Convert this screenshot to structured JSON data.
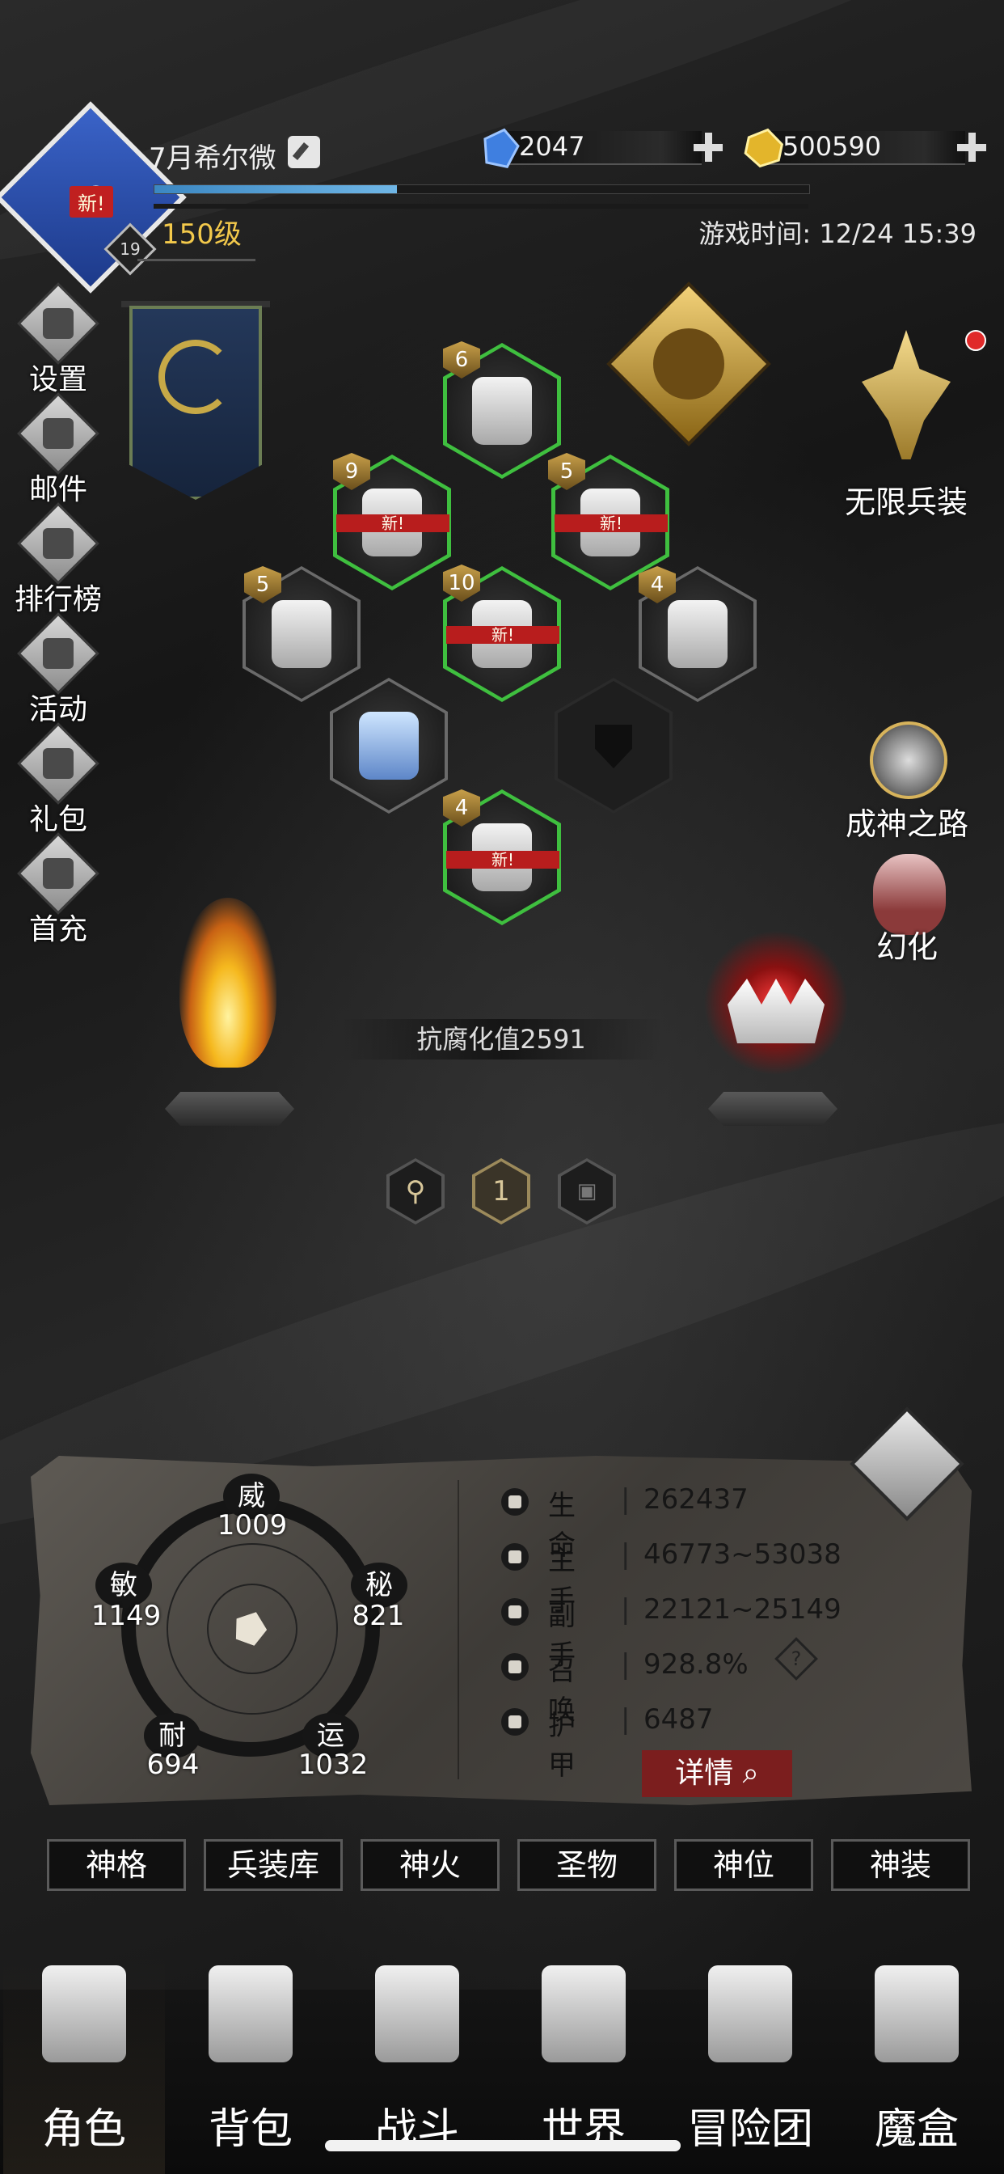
{
  "header": {
    "player_name": "7月希尔微",
    "avatar_new_tag": "新!",
    "avatar_badge": "19",
    "level": "150级",
    "game_time": "游戏时间: 12/24 15:39",
    "xp_progress": 0.37
  },
  "currency": {
    "gems": "2047",
    "gold": "500590"
  },
  "sidebar": {
    "items": [
      {
        "label": "设置",
        "icon": "gear-icon"
      },
      {
        "label": "邮件",
        "icon": "mail-icon"
      },
      {
        "label": "排行榜",
        "icon": "leaderboard-icon"
      },
      {
        "label": "活动",
        "icon": "event-icon"
      },
      {
        "label": "礼包",
        "icon": "gift-icon"
      },
      {
        "label": "首充",
        "icon": "first-recharge-icon"
      }
    ]
  },
  "equipment": {
    "new_tag": "新!",
    "slots": [
      {
        "name": "hat",
        "level": "6",
        "new": false
      },
      {
        "name": "gloves",
        "level": "9",
        "new": true
      },
      {
        "name": "amulet",
        "level": "5",
        "new": true
      },
      {
        "name": "belt",
        "level": "5",
        "new": false
      },
      {
        "name": "armor",
        "level": "10",
        "new": true
      },
      {
        "name": "cloak",
        "level": "4",
        "new": false
      },
      {
        "name": "weapon",
        "level": "",
        "new": false
      },
      {
        "name": "shield",
        "level": "",
        "new": false
      },
      {
        "name": "boots",
        "level": "4",
        "new": true
      }
    ]
  },
  "features": {
    "infinite_weapon": "无限兵装",
    "path_to_godhood": "成神之路",
    "transform": "幻化"
  },
  "corruption_resistance": "抗腐化值2591",
  "pages": {
    "current": "1"
  },
  "attributes": {
    "wei": {
      "name": "威",
      "value": "1009"
    },
    "mi": {
      "name": "秘",
      "value": "821"
    },
    "yun": {
      "name": "运",
      "value": "1032"
    },
    "nai": {
      "name": "耐",
      "value": "694"
    },
    "min": {
      "name": "敏",
      "value": "1149"
    }
  },
  "stats": {
    "separator": "|",
    "rows": [
      {
        "label": "生命",
        "value": "262437"
      },
      {
        "label": "主手",
        "value": "46773~53038"
      },
      {
        "label": "副手",
        "value": "22121~25149"
      },
      {
        "label": "召唤",
        "value": "928.8%"
      },
      {
        "label": "护甲",
        "value": "6487"
      }
    ],
    "help_label": "?",
    "detail_button": "详情"
  },
  "tabs": [
    "神格",
    "兵装库",
    "神火",
    "圣物",
    "神位",
    "神装"
  ],
  "nav": [
    {
      "label": "角色",
      "icon": "helmet-icon"
    },
    {
      "label": "背包",
      "icon": "backpack-icon"
    },
    {
      "label": "战斗",
      "icon": "sword-shield-icon"
    },
    {
      "label": "世界",
      "icon": "map-icon"
    },
    {
      "label": "冒险团",
      "icon": "castle-icon"
    },
    {
      "label": "魔盒",
      "icon": "cube-icon"
    }
  ]
}
